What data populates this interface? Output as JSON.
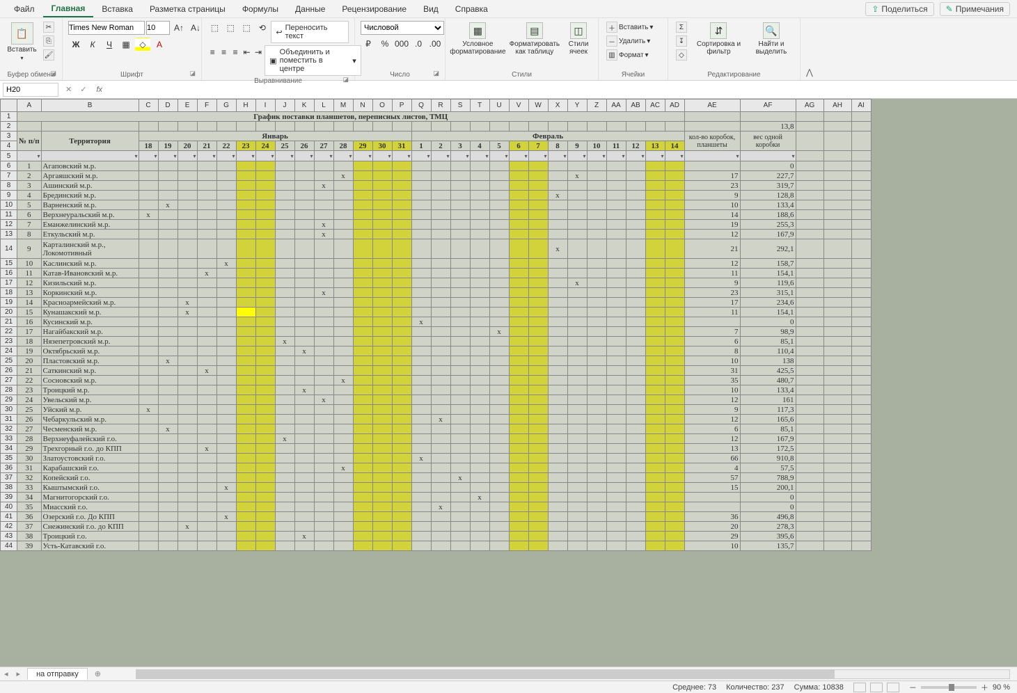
{
  "menu": {
    "tabs": [
      "Файл",
      "Главная",
      "Вставка",
      "Разметка страницы",
      "Формулы",
      "Данные",
      "Рецензирование",
      "Вид",
      "Справка"
    ],
    "active": 1,
    "share": "Поделиться",
    "comments": "Примечания"
  },
  "ribbon": {
    "clipboard": {
      "paste": "Вставить",
      "label": "Буфер обмена"
    },
    "font": {
      "name": "Times New Roman",
      "size": "10",
      "label": "Шрифт"
    },
    "align": {
      "wrap": "Переносить текст",
      "merge": "Объединить и поместить в центре",
      "label": "Выравнивание"
    },
    "number": {
      "format": "Числовой",
      "label": "Число"
    },
    "styles": {
      "cond": "Условное форматирование",
      "table": "Форматировать как таблицу",
      "cell": "Стили ячеек",
      "label": "Стили"
    },
    "cells": {
      "insert": "Вставить",
      "delete": "Удалить",
      "format": "Формат",
      "label": "Ячейки"
    },
    "editing": {
      "sort": "Сортировка и фильтр",
      "find": "Найти и выделить",
      "label": "Редактирование"
    }
  },
  "namebox": "H20",
  "sheet": {
    "title": "График поставки планшетов, переписных листов, ТМЦ",
    "hdr_np": "№ п/п",
    "hdr_terr": "Территория",
    "hdr_jan": "Январь",
    "hdr_feb": "Февраль",
    "hdr_boxes": "кол-во коробок, планшеты",
    "hdr_weight": "вес одной коробки",
    "val_138": "13,8",
    "days_jan": [
      "18",
      "19",
      "20",
      "21",
      "22",
      "23",
      "24",
      "25",
      "26",
      "27",
      "28",
      "29",
      "30",
      "31"
    ],
    "days_feb": [
      "1",
      "2",
      "3",
      "4",
      "5",
      "6",
      "7",
      "8",
      "9",
      "10",
      "11",
      "12",
      "13",
      "14"
    ],
    "ylw_jan": [
      5,
      6,
      11,
      12,
      13
    ],
    "ylw_feb": [
      5,
      6,
      12,
      13
    ],
    "rows": [
      {
        "n": 1,
        "name": "Агаповский м.р.",
        "marks": {},
        "boxes": "",
        "weight": "0"
      },
      {
        "n": 2,
        "name": "Аргаяшский м.р.",
        "marks": {
          "j10": "x",
          "f8": "x"
        },
        "boxes": "17",
        "weight": "227,7"
      },
      {
        "n": 3,
        "name": "Ашинский м.р.",
        "marks": {
          "j9": "x"
        },
        "boxes": "23",
        "weight": "319,7"
      },
      {
        "n": 4,
        "name": "Брединский м.р.",
        "marks": {
          "f7": "x"
        },
        "boxes": "9",
        "weight": "128,8"
      },
      {
        "n": 5,
        "name": "Варненский м.р.",
        "marks": {
          "j1": "x"
        },
        "boxes": "10",
        "weight": "133,4"
      },
      {
        "n": 6,
        "name": "Верхнеуральский м.р.",
        "marks": {
          "j0": "x"
        },
        "boxes": "14",
        "weight": "188,6"
      },
      {
        "n": 7,
        "name": "Еманжелинский м.р.",
        "marks": {
          "j9": "x"
        },
        "boxes": "19",
        "weight": "255,3"
      },
      {
        "n": 8,
        "name": "Еткульский м.р.",
        "marks": {
          "j9": "x"
        },
        "boxes": "12",
        "weight": "167,9"
      },
      {
        "n": 9,
        "name": "Карталинский м.р., Локомотивный",
        "marks": {
          "f7": "x"
        },
        "boxes": "21",
        "weight": "292,1"
      },
      {
        "n": 10,
        "name": "Каслинский м.р.",
        "marks": {
          "j4": "x"
        },
        "boxes": "12",
        "weight": "158,7"
      },
      {
        "n": 11,
        "name": "Катав-Ивановский м.р.",
        "marks": {
          "j3": "x"
        },
        "boxes": "11",
        "weight": "154,1"
      },
      {
        "n": 12,
        "name": "Кизильский м.р.",
        "marks": {
          "f8": "x"
        },
        "boxes": "9",
        "weight": "119,6"
      },
      {
        "n": 13,
        "name": "Коркинский м.р.",
        "marks": {
          "j9": "x"
        },
        "boxes": "23",
        "weight": "315,1"
      },
      {
        "n": 14,
        "name": "Красноармейский м.р.",
        "marks": {
          "j2": "x"
        },
        "boxes": "17",
        "weight": "234,6"
      },
      {
        "n": 15,
        "name": "Кунашакский м.р.",
        "marks": {
          "j2": "x"
        },
        "boxes": "11",
        "weight": "154,1",
        "hlcell": "j5"
      },
      {
        "n": 16,
        "name": "Кусинский м.р.",
        "marks": {
          "f0": "x"
        },
        "boxes": "",
        "weight": "0"
      },
      {
        "n": 17,
        "name": "Нагайбакский м.р.",
        "marks": {
          "f4": "x"
        },
        "boxes": "7",
        "weight": "98,9"
      },
      {
        "n": 18,
        "name": "Нязепетровский м.р.",
        "marks": {
          "j7": "x"
        },
        "boxes": "6",
        "weight": "85,1"
      },
      {
        "n": 19,
        "name": "Октябрьский м.р.",
        "marks": {
          "j8": "x"
        },
        "boxes": "8",
        "weight": "110,4"
      },
      {
        "n": 20,
        "name": "Пластовский м.р.",
        "marks": {
          "j1": "x"
        },
        "boxes": "10",
        "weight": "138"
      },
      {
        "n": 21,
        "name": "Саткинский м.р.",
        "marks": {
          "j3": "x"
        },
        "boxes": "31",
        "weight": "425,5"
      },
      {
        "n": 22,
        "name": "Сосновский м.р.",
        "marks": {
          "j10": "x"
        },
        "boxes": "35",
        "weight": "480,7"
      },
      {
        "n": 23,
        "name": "Троицкий м.р.",
        "marks": {
          "j8": "x"
        },
        "boxes": "10",
        "weight": "133,4"
      },
      {
        "n": 24,
        "name": "Увельский м.р.",
        "marks": {
          "j9": "x"
        },
        "boxes": "12",
        "weight": "161"
      },
      {
        "n": 25,
        "name": "Уйский м.р.",
        "marks": {
          "j0": "x"
        },
        "boxes": "9",
        "weight": "117,3"
      },
      {
        "n": 26,
        "name": "Чебаркульский м.р.",
        "marks": {
          "f1": "x"
        },
        "boxes": "12",
        "weight": "165,6"
      },
      {
        "n": 27,
        "name": "Чесменский м.р.",
        "marks": {
          "j1": "x"
        },
        "boxes": "6",
        "weight": "85,1"
      },
      {
        "n": 28,
        "name": "Верхнеуфалейский г.о.",
        "marks": {
          "j7": "x"
        },
        "boxes": "12",
        "weight": "167,9"
      },
      {
        "n": 29,
        "name": "Трехгорный г.о. до КПП",
        "marks": {
          "j3": "x"
        },
        "boxes": "13",
        "weight": "172,5"
      },
      {
        "n": 30,
        "name": "Златоустовский г.о.",
        "marks": {
          "f0": "x"
        },
        "boxes": "66",
        "weight": "910,8"
      },
      {
        "n": 31,
        "name": "Карабашский г.о.",
        "marks": {
          "j10": "x"
        },
        "boxes": "4",
        "weight": "57,5"
      },
      {
        "n": 32,
        "name": "Копейский г.о.",
        "marks": {
          "f2": "x"
        },
        "boxes": "57",
        "weight": "788,9"
      },
      {
        "n": 33,
        "name": "Кыштымский г.о.",
        "marks": {
          "j4": "x"
        },
        "boxes": "15",
        "weight": "200,1"
      },
      {
        "n": 34,
        "name": "Магнитогорский г.о.",
        "marks": {
          "f3": "x"
        },
        "boxes": "",
        "weight": "0"
      },
      {
        "n": 35,
        "name": "Миасский г.о.",
        "marks": {
          "f1": "x"
        },
        "boxes": "",
        "weight": "0"
      },
      {
        "n": 36,
        "name": "Озерский г.о. До КПП",
        "marks": {
          "j4": "x"
        },
        "boxes": "36",
        "weight": "496,8"
      },
      {
        "n": 37,
        "name": "Снежинский г.о. до КПП",
        "marks": {
          "j2": "x"
        },
        "boxes": "20",
        "weight": "278,3"
      },
      {
        "n": 38,
        "name": "Троицкий г.о.",
        "marks": {
          "j8": "x"
        },
        "boxes": "29",
        "weight": "395,6"
      },
      {
        "n": 39,
        "name": "Усть-Катавский г.о.",
        "marks": {},
        "boxes": "10",
        "weight": "135,7"
      }
    ],
    "cols": [
      "A",
      "B",
      "C",
      "D",
      "E",
      "F",
      "G",
      "H",
      "I",
      "J",
      "K",
      "L",
      "M",
      "N",
      "O",
      "P",
      "Q",
      "R",
      "S",
      "T",
      "U",
      "V",
      "W",
      "X",
      "Y",
      "Z",
      "AA",
      "AB",
      "AC",
      "AD",
      "AE",
      "AF",
      "AG",
      "AH",
      "AI"
    ]
  },
  "tab": "на отправку",
  "status": {
    "avg": "Среднее: 73",
    "count": "Количество: 237",
    "sum": "Сумма: 10838",
    "zoom": "90 %"
  }
}
